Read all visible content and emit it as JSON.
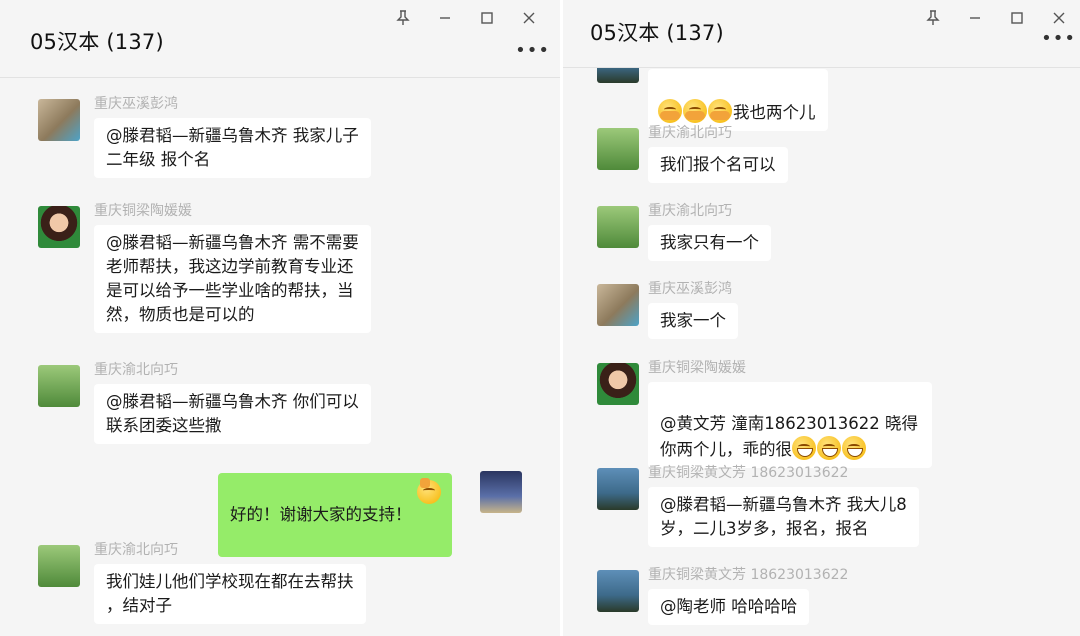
{
  "left": {
    "title": "05汉本 (137)",
    "controls": {
      "pin": "pin-icon",
      "minimize": "minimize-icon",
      "maximize": "maximize-icon",
      "close": "close-icon"
    },
    "messages": [
      {
        "sender": "重庆巫溪彭鸿",
        "text": "@滕君韬—新疆乌鲁木齐 我家儿子\n二年级 报个名"
      },
      {
        "sender": "重庆铜梁陶媛媛",
        "text": "@滕君韬—新疆乌鲁木齐 需不需要\n老师帮扶，我这边学前教育专业还\n是可以给予一些学业啥的帮扶，当\n然，物质也是可以的"
      },
      {
        "sender": "重庆渝北向巧",
        "text": "@滕君韬—新疆乌鲁木齐 你们可以\n联系团委这些撒"
      },
      {
        "sender": "",
        "text": "好的！谢谢大家的支持！",
        "mine": true
      },
      {
        "sender": "重庆渝北向巧",
        "text": "我们娃儿他们学校现在都在去帮扶\n，结对子"
      }
    ]
  },
  "right": {
    "title": "05汉本 (137)",
    "messages": [
      {
        "sender": "",
        "text": "我也两个儿"
      },
      {
        "sender": "重庆渝北向巧",
        "text": "我们报个名可以"
      },
      {
        "sender": "重庆渝北向巧",
        "text": "我家只有一个"
      },
      {
        "sender": "重庆巫溪彭鸿",
        "text": "我家一个"
      },
      {
        "sender": "重庆铜梁陶媛媛",
        "text": "@黄文芳 潼南18623013622 晓得\n你两个儿，乖的很"
      },
      {
        "sender": "重庆铜梁黄文芳 18623013622",
        "text": "@滕君韬—新疆乌鲁木齐 我大儿8\n岁，二儿3岁多，报名，报名"
      },
      {
        "sender": "重庆铜梁黄文芳 18623013622",
        "text": "@陶老师 哈哈哈哈"
      }
    ]
  },
  "colors": {
    "background": "#f5f5f5",
    "bubble": "#ffffff",
    "my_bubble": "#95ec69",
    "sender_text": "#b2b2b2"
  }
}
